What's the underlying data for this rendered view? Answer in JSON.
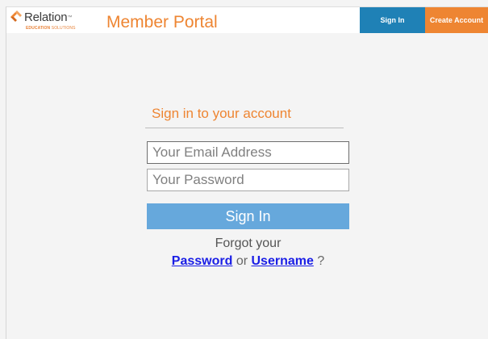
{
  "header": {
    "logo": {
      "name": "Relation",
      "tagline_bold": "EDUCATION",
      "tagline_rest": " SOLUTIONS"
    },
    "portal_title": "Member Portal",
    "nav": {
      "sign_in_label": "Sign In",
      "create_account_label": "Create Account"
    }
  },
  "form": {
    "heading": "Sign in to your account",
    "email_placeholder": "Your Email Address",
    "email_value": "",
    "password_placeholder": "Your Password",
    "password_value": "",
    "submit_label": "Sign In",
    "forgot_text": "Forgot your",
    "password_link": "Password",
    "or_text": " or ",
    "username_link": "Username",
    "question_suffix": " ?"
  },
  "colors": {
    "brand_orange": "#ee8532",
    "nav_blue": "#1f81b6",
    "submit_blue": "#66a8dc",
    "link_blue": "#1a1ee6"
  }
}
